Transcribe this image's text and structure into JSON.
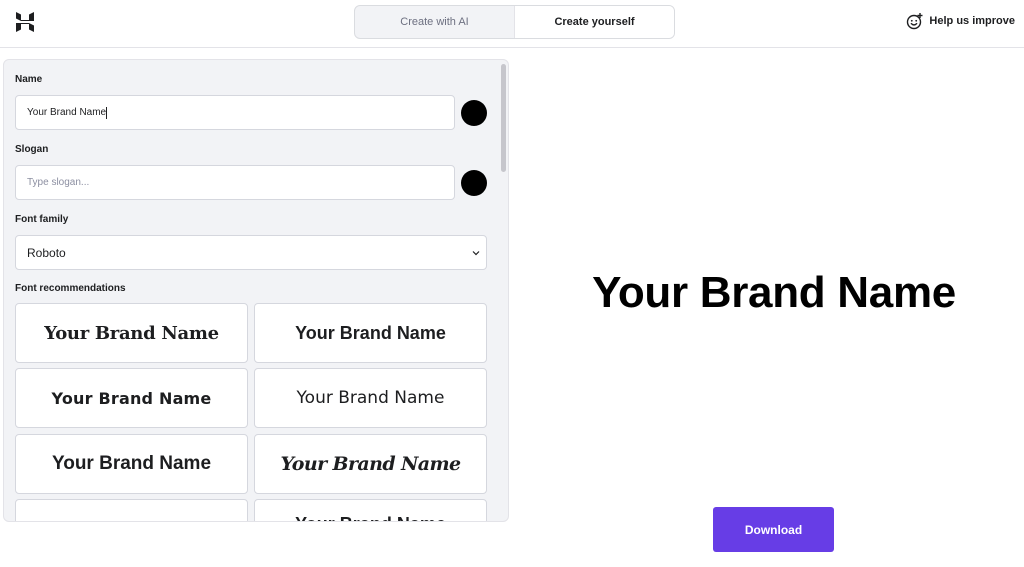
{
  "header": {
    "logo": "hostinger-logo-icon",
    "tabs": [
      {
        "label": "Create with AI",
        "active": false
      },
      {
        "label": "Create yourself",
        "active": true
      }
    ],
    "help_label": "Help us improve",
    "help_icon": "smiley-plus-icon"
  },
  "editor": {
    "name": {
      "label": "Name",
      "value": "Your Brand Name",
      "color": "#000000"
    },
    "slogan": {
      "label": "Slogan",
      "placeholder": "Type slogan...",
      "value": "",
      "color": "#000000"
    },
    "font_family": {
      "label": "Font family",
      "selected": "Roboto"
    },
    "font_recommendations": {
      "label": "Font recommendations",
      "items": [
        {
          "text": "Your Brand Name",
          "style": "serif-bold"
        },
        {
          "text": "Your Brand Name",
          "style": "sans-bold"
        },
        {
          "text": "Your Brand Name",
          "style": "sans-wide"
        },
        {
          "text": "Your Brand Name",
          "style": "sans-regular"
        },
        {
          "text": "Your Brand Name",
          "style": "sans-heavy"
        },
        {
          "text": "Your Brand Name",
          "style": "script"
        },
        {
          "text": "",
          "style": "partial"
        },
        {
          "text": "Your Brand Name",
          "style": "partial"
        }
      ]
    }
  },
  "preview": {
    "brand_name": "Your Brand Name",
    "download_label": "Download"
  },
  "colors": {
    "accent": "#673de6",
    "panel_bg": "#f2f3f6",
    "text": "#1d1e20"
  }
}
